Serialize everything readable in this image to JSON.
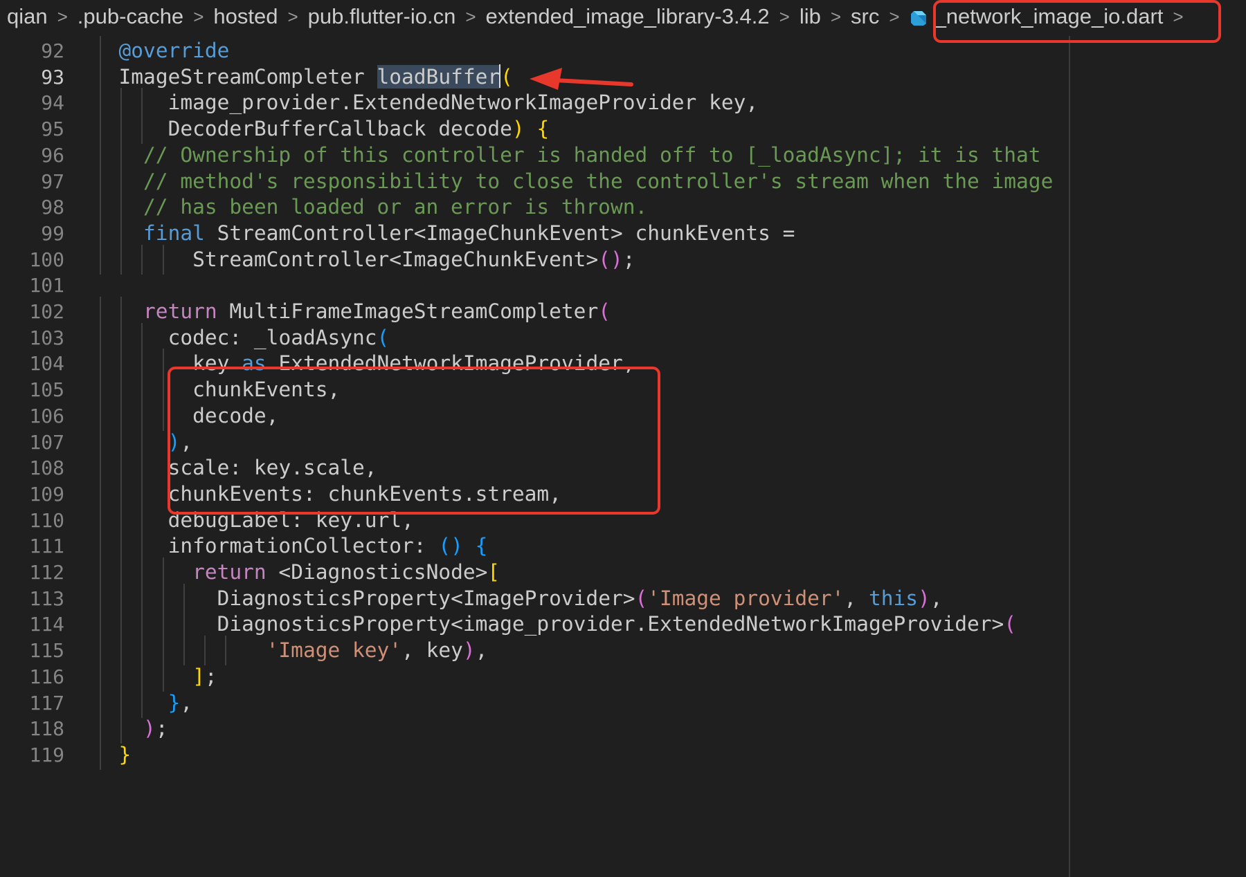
{
  "breadcrumb": {
    "items": [
      "qian",
      ".pub-cache",
      "hosted",
      "pub.flutter-io.cn",
      "extended_image_library-3.4.2",
      "lib",
      "src"
    ],
    "file": "_network_image_io.dart",
    "separator": ">"
  },
  "theme": {
    "background": "#1f1f1f",
    "default": "#cccccc",
    "keyword_blue": "#569cd6",
    "control_purple": "#c586c0",
    "type_teal": "#4ec9b0",
    "function_yellow": "#dcdcaa",
    "variable_blue": "#9cdcfe",
    "string_orange": "#ce9178",
    "comment_green": "#6a9955",
    "bracket_gold": "#ffd700",
    "bracket_purple": "#da70d6",
    "bracket_blue": "#179fff",
    "annotation_red": "#e8382c"
  },
  "editor": {
    "active_line": 93,
    "lines": [
      {
        "num": "92",
        "text": "  @override"
      },
      {
        "num": "93",
        "text": "  ImageStreamCompleter loadBuffer("
      },
      {
        "num": "94",
        "text": "      image_provider.ExtendedNetworkImageProvider key,"
      },
      {
        "num": "95",
        "text": "      DecoderBufferCallback decode) {"
      },
      {
        "num": "96",
        "text": "    // Ownership of this controller is handed off to [_loadAsync]; it is that"
      },
      {
        "num": "97",
        "text": "    // method's responsibility to close the controller's stream when the image"
      },
      {
        "num": "98",
        "text": "    // has been loaded or an error is thrown."
      },
      {
        "num": "99",
        "text": "    final StreamController<ImageChunkEvent> chunkEvents ="
      },
      {
        "num": "100",
        "text": "        StreamController<ImageChunkEvent>();"
      },
      {
        "num": "101",
        "text": ""
      },
      {
        "num": "102",
        "text": "    return MultiFrameImageStreamCompleter("
      },
      {
        "num": "103",
        "text": "      codec: _loadAsync("
      },
      {
        "num": "104",
        "text": "        key as ExtendedNetworkImageProvider,"
      },
      {
        "num": "105",
        "text": "        chunkEvents,"
      },
      {
        "num": "106",
        "text": "        decode,"
      },
      {
        "num": "107",
        "text": "      ),"
      },
      {
        "num": "108",
        "text": "      scale: key.scale,"
      },
      {
        "num": "109",
        "text": "      chunkEvents: chunkEvents.stream,"
      },
      {
        "num": "110",
        "text": "      debugLabel: key.url,"
      },
      {
        "num": "111",
        "text": "      informationCollector: () {"
      },
      {
        "num": "112",
        "text": "        return <DiagnosticsNode>["
      },
      {
        "num": "113",
        "text": "          DiagnosticsProperty<ImageProvider>('Image provider', this),"
      },
      {
        "num": "114",
        "text": "          DiagnosticsProperty<image_provider.ExtendedNetworkImageProvider>("
      },
      {
        "num": "115",
        "text": "              'Image key', key),"
      },
      {
        "num": "116",
        "text": "        ];"
      },
      {
        "num": "117",
        "text": "      },"
      },
      {
        "num": "118",
        "text": "    );"
      },
      {
        "num": "119",
        "text": "  }"
      }
    ]
  }
}
